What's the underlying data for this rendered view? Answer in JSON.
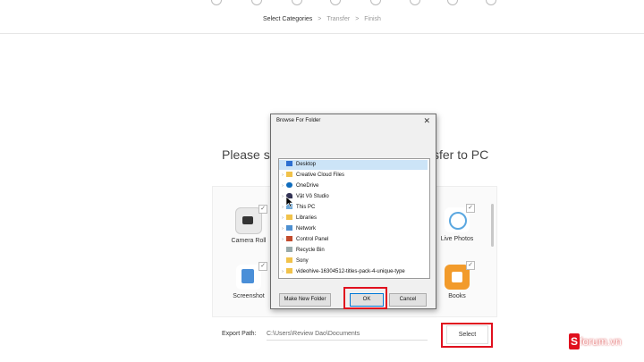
{
  "steps": {
    "step1": "Select Categories",
    "step2": "Transfer",
    "step3": "Finish",
    "sep": ">"
  },
  "heading": {
    "left": "Please se",
    "right": "sfer to PC"
  },
  "apps": [
    {
      "label": "Camera Roll",
      "icon": "camera-icon"
    },
    {
      "label": "Live Photos",
      "icon": "live-photos-icon"
    },
    {
      "label": "Screenshot",
      "icon": "screenshot-icon"
    },
    {
      "label": "Books",
      "icon": "books-icon"
    }
  ],
  "export": {
    "label": "Export Path:",
    "path": "C:\\Users\\Review Dao\\Documents",
    "select_label": "Select"
  },
  "dialog": {
    "title": "Browse For Folder",
    "close_glyph": "✕",
    "tree": [
      {
        "label": "Desktop",
        "icon": "desktop-icon",
        "selected": true
      },
      {
        "label": "Creative Cloud Files",
        "icon": "folder-icon"
      },
      {
        "label": "OneDrive",
        "icon": "onedrive-icon"
      },
      {
        "label": "Vật Vô Studio",
        "icon": "user-icon"
      },
      {
        "label": "This PC",
        "icon": "pc-icon"
      },
      {
        "label": "Libraries",
        "icon": "folder-icon"
      },
      {
        "label": "Network",
        "icon": "network-icon"
      },
      {
        "label": "Control Panel",
        "icon": "control-panel-icon"
      },
      {
        "label": "Recycle Bin",
        "icon": "recycle-bin-icon"
      },
      {
        "label": "Sony",
        "icon": "folder-icon"
      },
      {
        "label": "videohive-16304512-titles-pack-4-unique-type",
        "icon": "folder-icon"
      }
    ],
    "new_folder_label": "Make New Folder",
    "ok_label": "OK",
    "cancel_label": "Cancel"
  },
  "watermark": {
    "s": "S",
    "rest": "forum.vn"
  },
  "colors": {
    "highlight": "#e0101e",
    "selection": "#cce4f7"
  }
}
